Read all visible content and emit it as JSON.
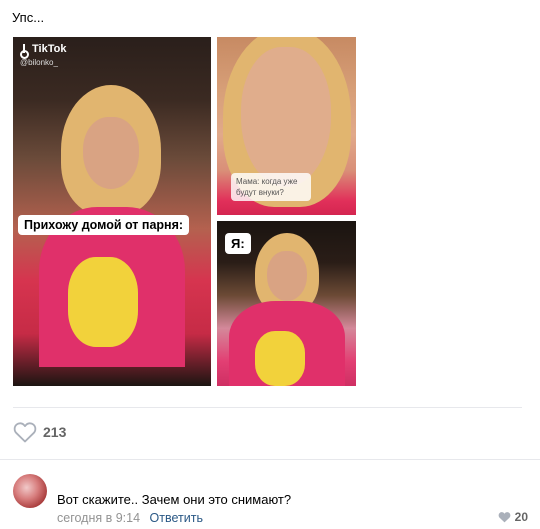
{
  "post": {
    "text": "Упс...",
    "likes_count": "213"
  },
  "photos": {
    "main": {
      "watermark": "TikTok",
      "handle": "@bilonko_",
      "caption": "Прихожу домой от парня:"
    },
    "top_right": {
      "caption": "Мама: когда уже будут внуки?"
    },
    "bottom_right": {
      "caption": "Я:"
    }
  },
  "comment": {
    "text": "Вот скажите.. Зачем они это снимают?",
    "timestamp": "сегодня в 9:14",
    "reply_label": "Ответить",
    "likes_count": "20"
  },
  "colors": {
    "link": "#2a5885",
    "muted": "#939393",
    "divider": "#e7e8ec",
    "like_icon": "#aab0ba"
  }
}
